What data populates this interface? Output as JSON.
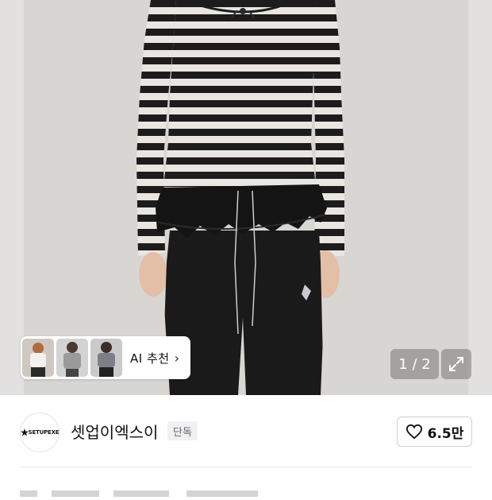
{
  "gallery": {
    "counter": "1 / 2",
    "ai_recommend_label": "AI 추천",
    "ai_recommend_arrow": "›"
  },
  "brand": {
    "name": "셋업이엑스이",
    "logo_text": "SETUPEXE",
    "badge": "단독"
  },
  "like": {
    "count": "6.5만"
  },
  "colors": {
    "stripe_dark": "#1c1c1c",
    "stripe_light": "#e9e6e2",
    "pants": "#1a1a1a",
    "background": "#d8d6d3"
  },
  "icons": {
    "expand": "expand-icon",
    "heart": "heart-icon",
    "chevron": "chevron-right-icon"
  }
}
